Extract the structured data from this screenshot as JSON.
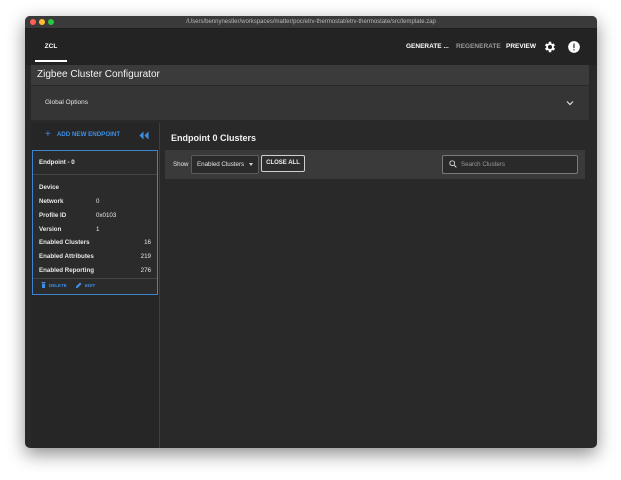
{
  "window": {
    "title": "/Users/bennynestler/workspaces/matter/poc/etrv-thermostat/etrv-thermostate/src/template.zap"
  },
  "toolbar": {
    "tab_zcl": "ZCL",
    "generate_label": "GENERATE ...",
    "regenerate_label": "REGENERATE",
    "preview_label": "PREVIEW",
    "settings_icon": "gear-icon",
    "info_icon": "info-icon"
  },
  "app": {
    "title": "Zigbee Cluster Configurator",
    "global_options_label": "Global Options"
  },
  "sidebar": {
    "add_endpoint_label": "ADD NEW ENDPOINT",
    "endpoint": {
      "name": "Endpoint - 0",
      "rows": [
        {
          "label": "Device",
          "value": ""
        },
        {
          "label": "Network",
          "value": "0"
        },
        {
          "label": "Profile ID",
          "value": "0x0103"
        },
        {
          "label": "Version",
          "value": "1"
        },
        {
          "label": "Enabled Clusters",
          "value": "16"
        },
        {
          "label": "Enabled Attributes",
          "value": "219"
        },
        {
          "label": "Enabled Reporting",
          "value": "276"
        }
      ],
      "delete_label": "DELETE",
      "edit_label": "EDIT"
    }
  },
  "main": {
    "title": "Endpoint 0 Clusters",
    "show_label": "Show",
    "filter_selected": "Enabled Clusters",
    "close_all_label": "CLOSE ALL",
    "search_placeholder": "Search Clusters"
  },
  "colors": {
    "accent": "#3f8ee6",
    "background": "#292929",
    "panel": "#3a3a3a"
  }
}
